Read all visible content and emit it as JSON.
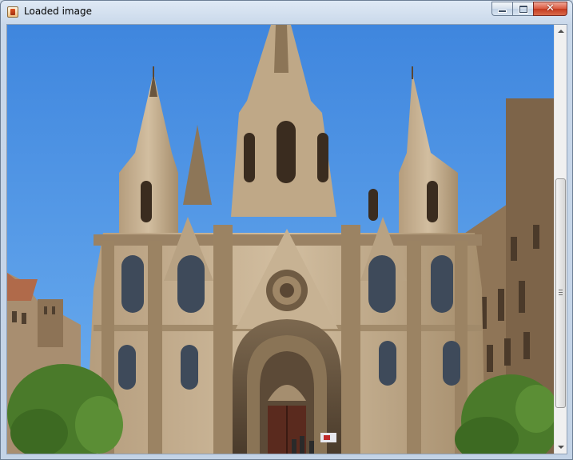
{
  "window": {
    "title": "Loaded image",
    "app_icon": "java-app-icon",
    "controls": {
      "minimize": "minimize-icon",
      "maximize": "maximize-icon",
      "close_label": "✕"
    }
  },
  "image": {
    "subject": "gothic-cathedral-facade-icon",
    "colors": {
      "sky": "#4b93e6",
      "stone": "#c6b194",
      "shadow": "#6f5c45",
      "foliage": "#4a7a2a"
    }
  },
  "scrollbar": {
    "orientation": "vertical",
    "position_fraction": 0.35
  }
}
